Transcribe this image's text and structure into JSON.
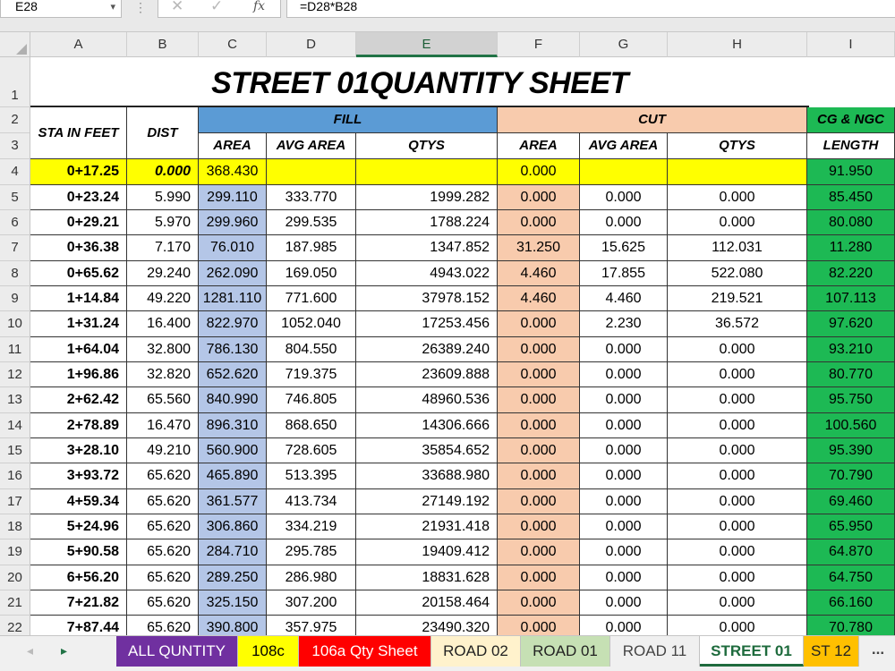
{
  "formula_bar": {
    "name_box": "E28",
    "name_box_arrow": "▾",
    "separator": "⋮",
    "cancel_icon": "✕",
    "enter_icon": "✓",
    "fx_label": "fx",
    "formula": "=D28*B28"
  },
  "column_headers": [
    "A",
    "B",
    "C",
    "D",
    "E",
    "F",
    "G",
    "H",
    "I"
  ],
  "row_headers": [
    "1",
    "2",
    "3",
    "4",
    "5",
    "6",
    "7",
    "8",
    "9",
    "10",
    "11",
    "12",
    "13",
    "14",
    "15",
    "16",
    "17",
    "18",
    "19",
    "20",
    "21",
    "22"
  ],
  "sheet": {
    "title": "STREET 01QUANTITY SHEET",
    "headers": {
      "sta": "STA IN FEET",
      "dist": "DIST",
      "fill": "FILL",
      "cut": "CUT",
      "cg": "CG & NGC",
      "area": "AREA",
      "avg_area": "AVG AREA",
      "qtys": "QTYS",
      "cut_area": "AREA",
      "cut_avg_area": "AVG AREA",
      "cut_qtys": "QTYS",
      "length": "LENGTH"
    },
    "colors": {
      "fill_header": "#5b9bd5",
      "fill_area": "#b4c6e7",
      "cut_header": "#f8cbad",
      "cut_area": "#f8cbad",
      "cg_green": "#1db954",
      "highlight_yellow": "#ffff00"
    },
    "rows": [
      [
        "0+17.25",
        "0.000",
        "368.430",
        "",
        "",
        "0.000",
        "",
        "",
        "91.950"
      ],
      [
        "0+23.24",
        "5.990",
        "299.110",
        "333.770",
        "1999.282",
        "0.000",
        "0.000",
        "0.000",
        "85.450"
      ],
      [
        "0+29.21",
        "5.970",
        "299.960",
        "299.535",
        "1788.224",
        "0.000",
        "0.000",
        "0.000",
        "80.080"
      ],
      [
        "0+36.38",
        "7.170",
        "76.010",
        "187.985",
        "1347.852",
        "31.250",
        "15.625",
        "112.031",
        "11.280"
      ],
      [
        "0+65.62",
        "29.240",
        "262.090",
        "169.050",
        "4943.022",
        "4.460",
        "17.855",
        "522.080",
        "82.220"
      ],
      [
        "1+14.84",
        "49.220",
        "1281.110",
        "771.600",
        "37978.152",
        "4.460",
        "4.460",
        "219.521",
        "107.113"
      ],
      [
        "1+31.24",
        "16.400",
        "822.970",
        "1052.040",
        "17253.456",
        "0.000",
        "2.230",
        "36.572",
        "97.620"
      ],
      [
        "1+64.04",
        "32.800",
        "786.130",
        "804.550",
        "26389.240",
        "0.000",
        "0.000",
        "0.000",
        "93.210"
      ],
      [
        "1+96.86",
        "32.820",
        "652.620",
        "719.375",
        "23609.888",
        "0.000",
        "0.000",
        "0.000",
        "80.770"
      ],
      [
        "2+62.42",
        "65.560",
        "840.990",
        "746.805",
        "48960.536",
        "0.000",
        "0.000",
        "0.000",
        "95.750"
      ],
      [
        "2+78.89",
        "16.470",
        "896.310",
        "868.650",
        "14306.666",
        "0.000",
        "0.000",
        "0.000",
        "100.560"
      ],
      [
        "3+28.10",
        "49.210",
        "560.900",
        "728.605",
        "35854.652",
        "0.000",
        "0.000",
        "0.000",
        "95.390"
      ],
      [
        "3+93.72",
        "65.620",
        "465.890",
        "513.395",
        "33688.980",
        "0.000",
        "0.000",
        "0.000",
        "70.790"
      ],
      [
        "4+59.34",
        "65.620",
        "361.577",
        "413.734",
        "27149.192",
        "0.000",
        "0.000",
        "0.000",
        "69.460"
      ],
      [
        "5+24.96",
        "65.620",
        "306.860",
        "334.219",
        "21931.418",
        "0.000",
        "0.000",
        "0.000",
        "65.950"
      ],
      [
        "5+90.58",
        "65.620",
        "284.710",
        "295.785",
        "19409.412",
        "0.000",
        "0.000",
        "0.000",
        "64.870"
      ],
      [
        "6+56.20",
        "65.620",
        "289.250",
        "286.980",
        "18831.628",
        "0.000",
        "0.000",
        "0.000",
        "64.750"
      ],
      [
        "7+21.82",
        "65.620",
        "325.150",
        "307.200",
        "20158.464",
        "0.000",
        "0.000",
        "0.000",
        "66.160"
      ],
      [
        "7+87.44",
        "65.620",
        "390.800",
        "357.975",
        "23490.320",
        "0.000",
        "0.000",
        "0.000",
        "70.780"
      ]
    ]
  },
  "tabs": [
    {
      "label": "ALL QUNTITY",
      "bg": "#7030a0",
      "fg": "#ffffff"
    },
    {
      "label": "108c",
      "bg": "#ffff00",
      "fg": "#000000"
    },
    {
      "label": "106a Qty Sheet",
      "bg": "#ff0000",
      "fg": "#ffffff"
    },
    {
      "label": "ROAD 02",
      "bg": "#fff2cc",
      "fg": "#222222"
    },
    {
      "label": "ROAD 01",
      "bg": "#c6e0b4",
      "fg": "#222222"
    },
    {
      "label": "ROAD 11",
      "bg": "#f0f0f0",
      "fg": "#444444"
    },
    {
      "label": "STREET 01",
      "bg": "#ffffff",
      "fg": "#1e6b3d"
    },
    {
      "label": "ST 12",
      "bg": "#ffc000",
      "fg": "#222222"
    }
  ],
  "tab_nav": {
    "prev": "◂",
    "next": "▸",
    "more": "..."
  }
}
